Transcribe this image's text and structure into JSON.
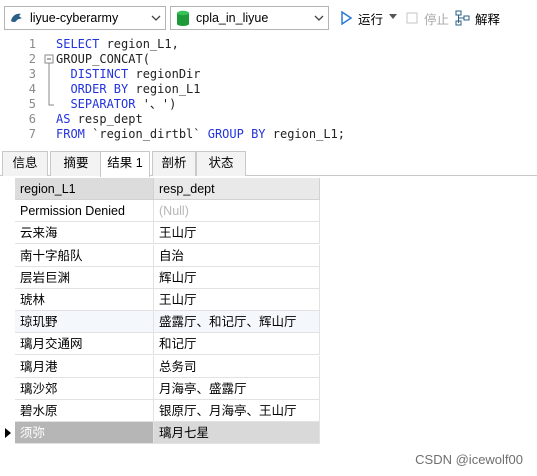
{
  "toolbar": {
    "connection": "liyue-cyberarmy",
    "database": "cpla_in_liyue",
    "run_label": "运行",
    "stop_label": "停止",
    "explain_label": "解释"
  },
  "editor": {
    "lines": [
      {
        "num": "1",
        "parts": [
          {
            "t": "SELECT",
            "kw": true
          },
          {
            "t": " region_L1,",
            "kw": false
          }
        ]
      },
      {
        "num": "2",
        "parts": [
          {
            "t": "GROUP_CONCAT(",
            "kw": false
          }
        ]
      },
      {
        "num": "3",
        "parts": [
          {
            "t": "  DISTINCT",
            "kw": true
          },
          {
            "t": " regionDir",
            "kw": false
          }
        ]
      },
      {
        "num": "4",
        "parts": [
          {
            "t": "  ORDER BY",
            "kw": true
          },
          {
            "t": " region_L1",
            "kw": false
          }
        ]
      },
      {
        "num": "5",
        "parts": [
          {
            "t": "  SEPARATOR",
            "kw": true
          },
          {
            "t": " '、')",
            "kw": false
          }
        ]
      },
      {
        "num": "6",
        "parts": [
          {
            "t": "AS",
            "kw": true
          },
          {
            "t": " resp_dept",
            "kw": false
          }
        ]
      },
      {
        "num": "7",
        "parts": [
          {
            "t": "FROM",
            "kw": true
          },
          {
            "t": " `region_dirtbl` ",
            "kw": false
          },
          {
            "t": "GROUP BY",
            "kw": true
          },
          {
            "t": " region_L1;",
            "kw": false
          }
        ]
      }
    ]
  },
  "tabs": [
    "信息",
    "摘要",
    "结果 1",
    "剖析",
    "状态"
  ],
  "active_tab": "结果 1",
  "result": {
    "columns": [
      "region_L1",
      "resp_dept"
    ],
    "rows": [
      [
        "Permission Denied",
        "(Null)"
      ],
      [
        "云来海",
        "王山厅"
      ],
      [
        "南十字船队",
        "自治"
      ],
      [
        "层岩巨渊",
        "辉山厅"
      ],
      [
        "琥林",
        "王山厅"
      ],
      [
        "琼玑野",
        "盛露厅、和记厅、辉山厅"
      ],
      [
        "璃月交通网",
        "和记厅"
      ],
      [
        "璃月港",
        "总务司"
      ],
      [
        "璃沙郊",
        "月海亭、盛露厅"
      ],
      [
        "碧水原",
        "银原厅、月海亭、王山厅"
      ],
      [
        "须弥",
        "璃月七星"
      ]
    ],
    "selected_row": 10
  },
  "watermark": "CSDN @icewolf00",
  "colors": {
    "keyword": "#2233dd",
    "row_alt": "#f4f8fd",
    "selected": "#b6b6b6",
    "header": "#e9e9e9"
  },
  "icons": {
    "connection": "dolphin-icon",
    "database": "database-icon",
    "run": "play-icon",
    "stop": "stop-icon",
    "explain": "explain-icon"
  }
}
